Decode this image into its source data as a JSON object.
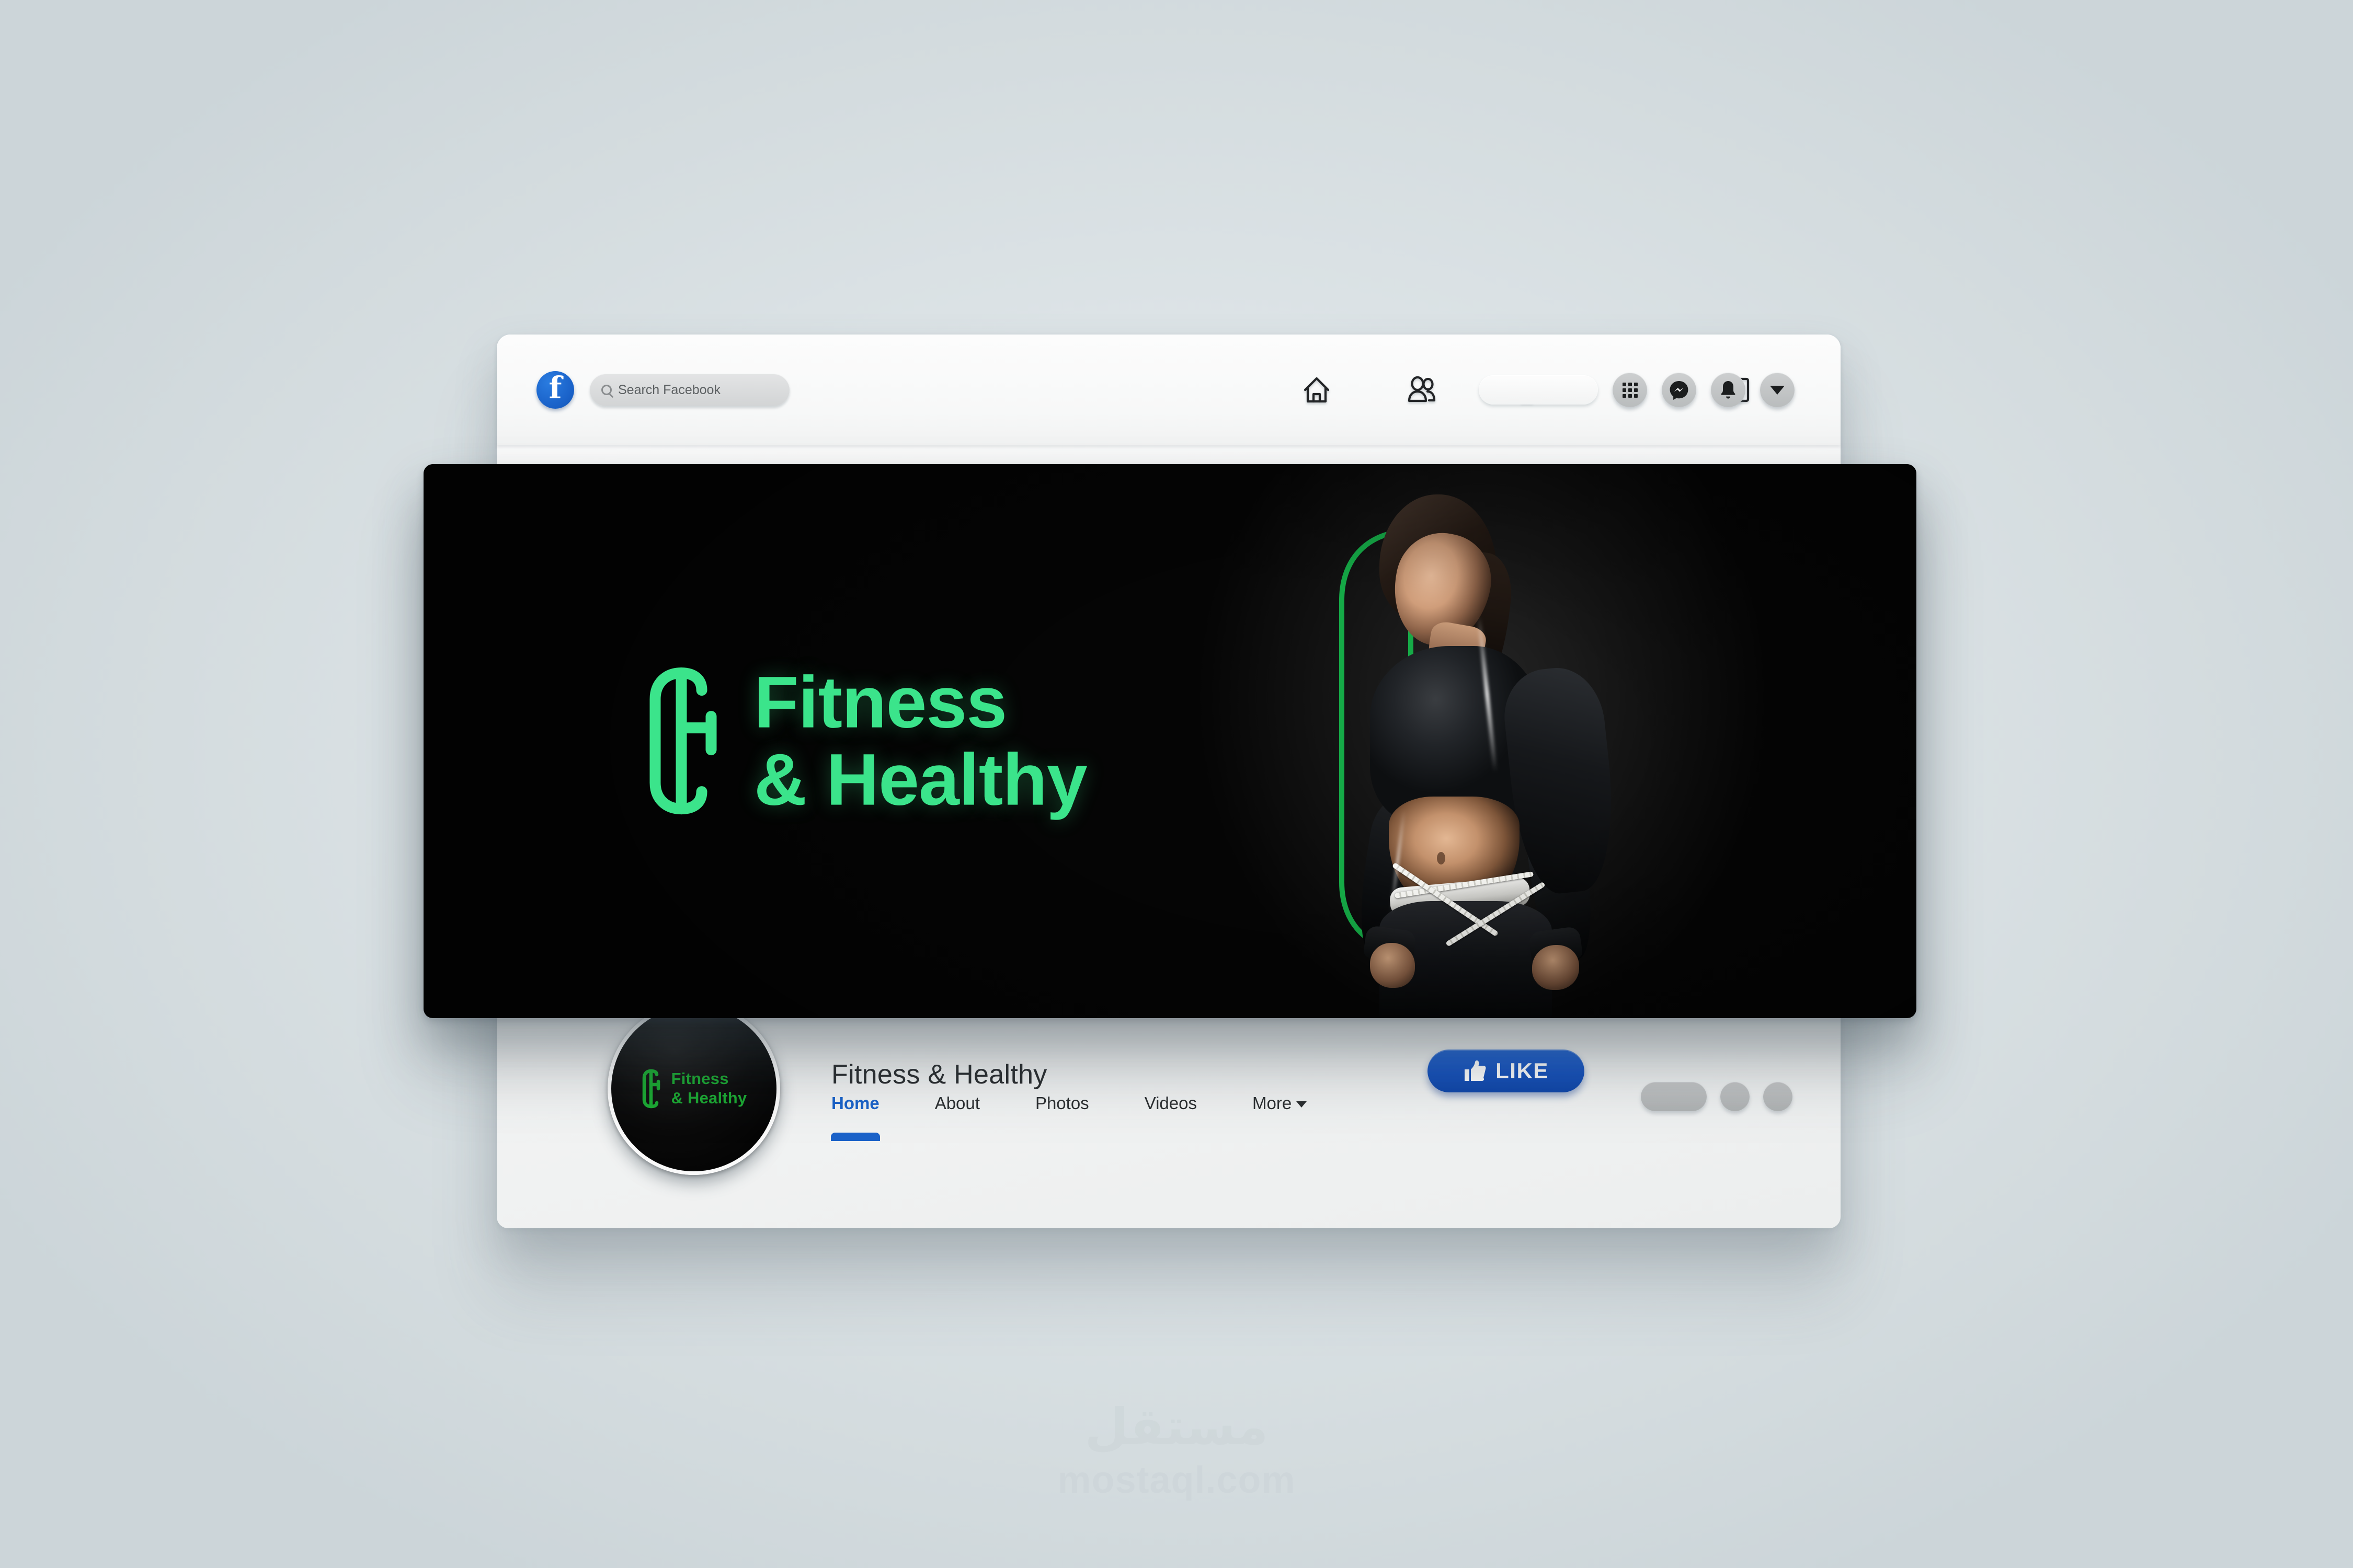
{
  "background": {
    "base_color": "#dce3e6"
  },
  "brand": {
    "name": "Fitness & Healthy",
    "accent_green": "#3be48b",
    "avatar_green": "#1ba832",
    "cover_background": "#000000",
    "wordmark_line1": "Fitness",
    "wordmark_line2": "& Healthy",
    "wordmark_full": "Fitness\n& Healthy",
    "logo_icon": "fitness-monogram-icon"
  },
  "topbar": {
    "logo_letter": "f",
    "logo_icon": "facebook-logo-icon",
    "search": {
      "placeholder": "Search Facebook",
      "value": "",
      "icon": "search-icon"
    },
    "nav": [
      {
        "id": "home",
        "icon": "home-icon"
      },
      {
        "id": "friends",
        "icon": "friends-icon"
      },
      {
        "id": "watch",
        "icon": "watch-video-icon"
      },
      {
        "id": "groups",
        "icon": "groups-icon"
      },
      {
        "id": "marketplace",
        "icon": "marketplace-icon"
      }
    ],
    "account_pill_label": "",
    "actions": [
      {
        "id": "menu",
        "icon": "grid-menu-icon"
      },
      {
        "id": "messenger",
        "icon": "messenger-icon"
      },
      {
        "id": "notifications",
        "icon": "bell-icon"
      },
      {
        "id": "account-menu",
        "icon": "chevron-down-icon"
      }
    ]
  },
  "cover": {
    "photo_subject": "fitness-model-measuring-waist",
    "ghost_monogram": "fitness-monogram-outline-icon"
  },
  "profile": {
    "page_name": "Fitness & Healthy",
    "avatar_wordmark": "Fitness\n& Healthy",
    "like_button": {
      "label": "LIKE",
      "icon": "thumbs-up-icon",
      "color": "#1551bd"
    }
  },
  "tabs": [
    {
      "label": "Home",
      "active": true
    },
    {
      "label": "About",
      "active": false
    },
    {
      "label": "Photos",
      "active": false
    },
    {
      "label": "Videos",
      "active": false
    },
    {
      "label": "More",
      "active": false,
      "has_caret": true
    }
  ],
  "tab_placeholders": [
    {
      "width": 126
    },
    {
      "width": 56
    },
    {
      "width": 56
    }
  ],
  "watermark": {
    "arabic": "مستقل",
    "url": "mostaql.com"
  }
}
